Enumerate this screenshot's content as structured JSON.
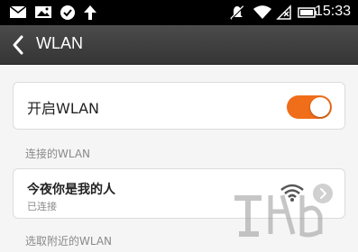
{
  "status_bar": {
    "time": "15:33",
    "left_icons": [
      "mail-icon",
      "image-icon",
      "check-circle-icon",
      "upload-arrow-icon"
    ],
    "right_icons": [
      "mute-icon",
      "wifi-icon",
      "signal-icon",
      "battery-icon"
    ]
  },
  "header": {
    "title": "WLAN",
    "back_icon": "chevron-left-icon"
  },
  "wlan_toggle": {
    "label": "开启WLAN",
    "enabled": true,
    "accent_color": "#f06d1a"
  },
  "connected_section": {
    "header": "连接的WLAN",
    "network": {
      "name": "今夜你是我的人",
      "status": "已连接",
      "signal_icon": "wifi-signal-icon",
      "detail_icon": "chevron-right-icon"
    }
  },
  "nearby_section": {
    "header": "选取附近的WLAN"
  }
}
